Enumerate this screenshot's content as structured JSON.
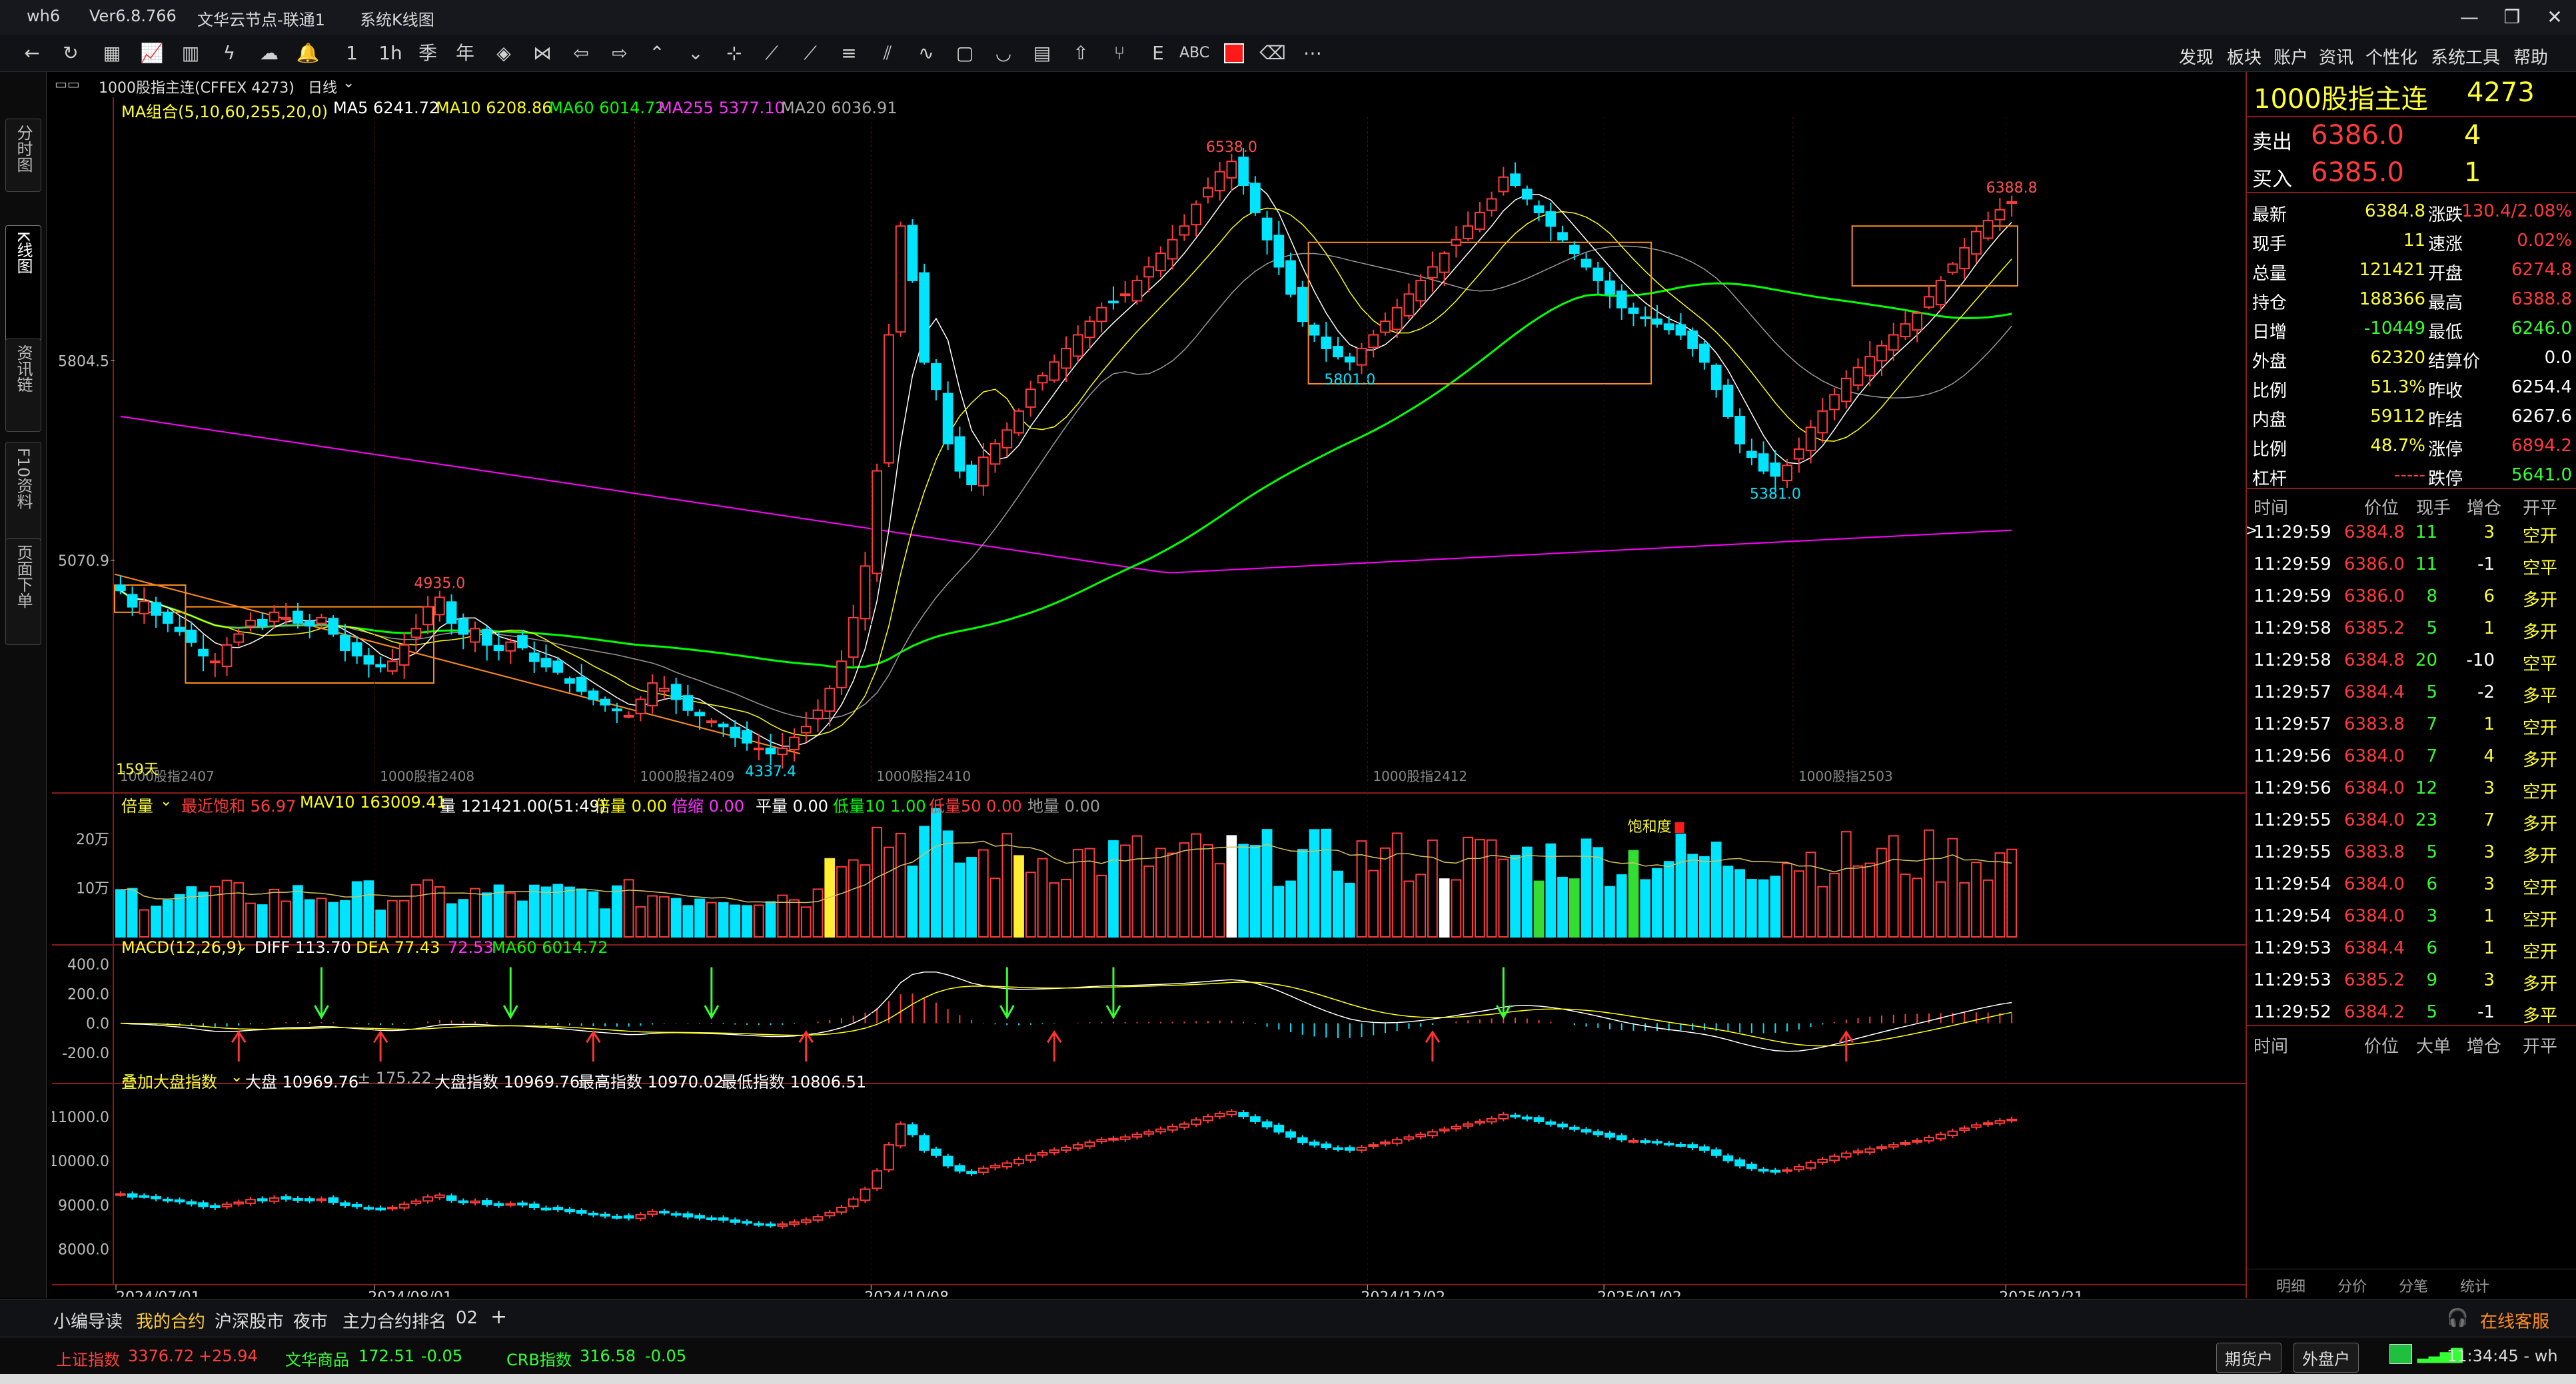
{
  "title_bar": {
    "app": "wh6",
    "version": "Ver6.8.766",
    "server": "文华云节点-联通1",
    "view": "系统K线图"
  },
  "menu": [
    "发现",
    "板块",
    "账户",
    "资讯",
    "个性化",
    "系统工具",
    "帮助"
  ],
  "left_tabs": [
    "分时图",
    "K线图",
    "资讯链",
    "F10资料",
    "页面下单"
  ],
  "contract_bar": {
    "name": "1000股指主连(CFFEX 4273)",
    "period": "日线"
  },
  "ma_legend": {
    "group": "MA组合(5,10,60,255,20,0)",
    "ma5": "MA5 6241.72",
    "ma10": "MA10 6208.86",
    "ma60": "MA60 6014.72",
    "ma255": "MA255 5377.10",
    "ma20": "MA20 6036.91"
  },
  "price_axis": {
    "labels": [
      {
        "v": 5804.5,
        "t": "5804.5"
      },
      {
        "v": 5070.9,
        "t": "5070.9"
      }
    ]
  },
  "annotations": {
    "high": "6538.0",
    "recent_high": "6388.8",
    "low_mid": "5801.0",
    "low_right": "5381.0",
    "left_high": "4935.0",
    "low": "4337.4",
    "days": "159天"
  },
  "contract_marks": [
    "1000股指2407",
    "1000股指2408",
    "1000股指2409",
    "1000股指2410",
    "1000股指2412",
    "1000股指2503"
  ],
  "volume_legend": {
    "name": "倍量",
    "a": "最近饱和 56.97",
    "b": "MAV10 163009.41",
    "c": "量 121421.00(51:49)",
    "d": "倍量 0.00",
    "e": "倍缩 0.00",
    "f": "平量 0.00",
    "g": "低量10 1.00",
    "h": "低量50 0.00",
    "i": "地量 0.00"
  },
  "volume_axis": [
    "20万",
    "10万"
  ],
  "volume_note": "饱和度",
  "macd_legend": {
    "name": "MACD(12,26,9)",
    "diff": "DIFF 113.70",
    "dea": "DEA 77.43",
    "macd": "72.53",
    "ma60": "MA60 6014.72"
  },
  "macd_axis": [
    "400.0",
    "200.0",
    "0.0",
    "-200.0"
  ],
  "index_legend": {
    "name": "叠加大盘指数",
    "a": "大盘 10969.76",
    "b": "± 175.22",
    "c": "大盘指数 10969.76",
    "d": "最高指数 10970.02",
    "e": "最低指数 10806.51"
  },
  "index_axis": [
    "11000.0",
    "10000.0",
    "9000.0",
    "8000.0"
  ],
  "date_axis": [
    "2024/07/01",
    "2024/08/01",
    "2024/10/08",
    "2024/12/02",
    "2025/01/02",
    "2025/02/21"
  ],
  "quote": {
    "name": "1000股指主连",
    "code": "4273",
    "ask_label": "卖出",
    "ask": "6386.0",
    "ask_vol": "4",
    "bid_label": "买入",
    "bid": "6385.0",
    "bid_vol": "1",
    "rows": [
      [
        "最新",
        "6384.8",
        "涨跌",
        "130.4/2.08%"
      ],
      [
        "现手",
        "11",
        "速涨",
        "0.02%"
      ],
      [
        "总量",
        "121421",
        "开盘",
        "6274.8"
      ],
      [
        "持仓",
        "188366",
        "最高",
        "6388.8"
      ],
      [
        "日增",
        "-10449",
        "最低",
        "6246.0"
      ],
      [
        "外盘",
        "62320",
        "结算价",
        "0.0"
      ],
      [
        "比例",
        "51.3%",
        "昨收",
        "6254.4"
      ],
      [
        "内盘",
        "59112",
        "昨结",
        "6267.6"
      ],
      [
        "比例",
        "48.7%",
        "涨停",
        "6894.2"
      ],
      [
        "杠杆",
        "-----",
        "跌停",
        "5641.0"
      ]
    ]
  },
  "trades_header": [
    "时间",
    "价位",
    "现手",
    "增仓",
    "开平"
  ],
  "trades": [
    [
      "11:29:59",
      "6384.8",
      "11",
      "3",
      "空开"
    ],
    [
      "11:29:59",
      "6386.0",
      "11",
      "-1",
      "空平"
    ],
    [
      "11:29:59",
      "6386.0",
      "8",
      "6",
      "多开"
    ],
    [
      "11:29:58",
      "6385.2",
      "5",
      "1",
      "多开"
    ],
    [
      "11:29:58",
      "6384.8",
      "20",
      "-10",
      "空平"
    ],
    [
      "11:29:57",
      "6384.4",
      "5",
      "-2",
      "多平"
    ],
    [
      "11:29:57",
      "6383.8",
      "7",
      "1",
      "空开"
    ],
    [
      "11:29:56",
      "6384.0",
      "7",
      "4",
      "多开"
    ],
    [
      "11:29:56",
      "6384.0",
      "12",
      "3",
      "空开"
    ],
    [
      "11:29:55",
      "6384.0",
      "23",
      "7",
      "多开"
    ],
    [
      "11:29:55",
      "6383.8",
      "5",
      "3",
      "多开"
    ],
    [
      "11:29:54",
      "6384.0",
      "6",
      "3",
      "空开"
    ],
    [
      "11:29:54",
      "6384.0",
      "3",
      "1",
      "空开"
    ],
    [
      "11:29:53",
      "6384.4",
      "6",
      "1",
      "空开"
    ],
    [
      "11:29:53",
      "6385.2",
      "9",
      "3",
      "多开"
    ],
    [
      "11:29:52",
      "6384.2",
      "5",
      "-1",
      "多平"
    ]
  ],
  "bigorder_header": [
    "时间",
    "价位",
    "大单",
    "增仓",
    "开平"
  ],
  "right_bottom_tabs": [
    "明细",
    "分价",
    "分笔",
    "统计"
  ],
  "bottom_tabs": [
    "小编导读",
    "我的合约",
    "沪深股市",
    "夜市",
    "主力合约排名",
    "02",
    "+"
  ],
  "service": "在线客服",
  "status": {
    "sh": "上证指数",
    "sh_val": "3376.72",
    "sh_chg": "+25.94",
    "wh": "文华商品",
    "wh_val": "172.51",
    "wh_chg": "-0.05",
    "crb": "CRB指数",
    "crb_val": "316.58",
    "crb_chg": "-0.05",
    "acct1": "期货户",
    "acct2": "外盘户",
    "time": "11:34:45 - wh"
  },
  "colors": {
    "up": "#ff3b3b",
    "down": "#00e5ff",
    "ma5": "#ffffff",
    "ma10": "#ffff00",
    "ma60": "#00ff00",
    "ma255": "#ff00ff",
    "ma20": "#999999"
  },
  "chart_data": {
    "type": "candlestick",
    "x_start": "2024/06/24",
    "x_end": "2025/02/21",
    "y_range": [
      4250,
      6700
    ],
    "ohlc_daily_close": [
      4960,
      4900,
      4920,
      4870,
      4840,
      4810,
      4770,
      4720,
      4700,
      4760,
      4800,
      4850,
      4830,
      4880,
      4860,
      4840,
      4830,
      4860,
      4800,
      4740,
      4720,
      4690,
      4680,
      4700,
      4760,
      4820,
      4900,
      4935,
      4840,
      4800,
      4820,
      4760,
      4740,
      4770,
      4750,
      4700,
      4680,
      4660,
      4620,
      4590,
      4560,
      4540,
      4520,
      4500,
      4560,
      4620,
      4600,
      4560,
      4520,
      4500,
      4480,
      4460,
      4420,
      4400,
      4380,
      4360,
      4380,
      4420,
      4460,
      4520,
      4600,
      4700,
      4860,
      5050,
      5400,
      5900,
      6300,
      6100,
      5800,
      5700,
      5500,
      5400,
      5350,
      5450,
      5500,
      5550,
      5620,
      5700,
      5750,
      5800,
      5850,
      5900,
      5950,
      6000,
      6020,
      6050,
      6100,
      6150,
      6200,
      6250,
      6300,
      6380,
      6440,
      6500,
      6538,
      6450,
      6350,
      6250,
      6150,
      6050,
      5950,
      5900,
      5850,
      5820,
      5801,
      5850,
      5900,
      5950,
      6000,
      6050,
      6100,
      6150,
      6200,
      6250,
      6300,
      6350,
      6400,
      6480,
      6450,
      6400,
      6350,
      6300,
      6250,
      6200,
      6150,
      6100,
      6050,
      6000,
      5980,
      5960,
      5940,
      5920,
      5900,
      5850,
      5800,
      5700,
      5600,
      5500,
      5450,
      5400,
      5381,
      5420,
      5480,
      5560,
      5620,
      5680,
      5740,
      5780,
      5820,
      5860,
      5900,
      5940,
      5980,
      6040,
      6100,
      6160,
      6220,
      6280,
      6320,
      6360,
      6389
    ],
    "volume_axis_max": 250000,
    "macd_range": [
      -300,
      450
    ],
    "index_range": [
      7800,
      11600
    ]
  }
}
